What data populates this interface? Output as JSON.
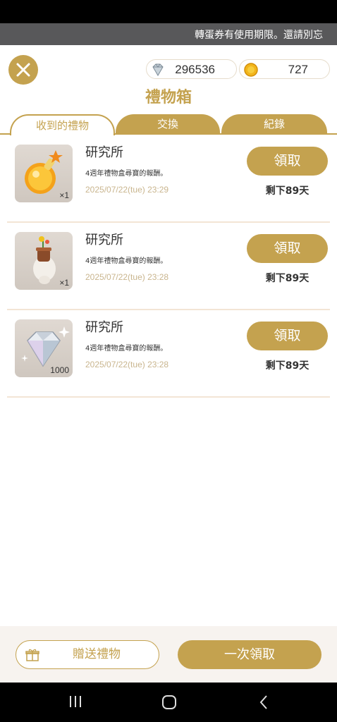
{
  "ticker": {
    "text": "轉蛋券有使用期限。還請別忘"
  },
  "currency": {
    "gems": "296536",
    "coins": "727"
  },
  "title": "禮物箱",
  "tabs": [
    {
      "label": "收到的禮物",
      "active": true
    },
    {
      "label": "交換",
      "active": false
    },
    {
      "label": "紀錄",
      "active": false
    }
  ],
  "gifts": [
    {
      "name": "研究所",
      "desc": "4週年禮物盒尋寶的報酬。",
      "date": "2025/07/22(tue) 23:29",
      "qty": "×1",
      "claim": "領取",
      "remaining": "剩下89天",
      "icon": "potion-icon"
    },
    {
      "name": "研究所",
      "desc": "4週年禮物盒尋寶的報酬。",
      "date": "2025/07/22(tue) 23:28",
      "qty": "×1",
      "claim": "領取",
      "remaining": "剩下89天",
      "icon": "flower-pot-icon"
    },
    {
      "name": "研究所",
      "desc": "4週年禮物盒尋寶的報酬。",
      "date": "2025/07/22(tue) 23:28",
      "qty": "1000",
      "claim": "領取",
      "remaining": "剩下89天",
      "icon": "diamond-icon"
    }
  ],
  "footer": {
    "send": "贈送禮物",
    "claim_all": "一次領取"
  },
  "colors": {
    "accent": "#c4a24f",
    "divider": "#f3e5d5",
    "date": "#c9b58e"
  }
}
